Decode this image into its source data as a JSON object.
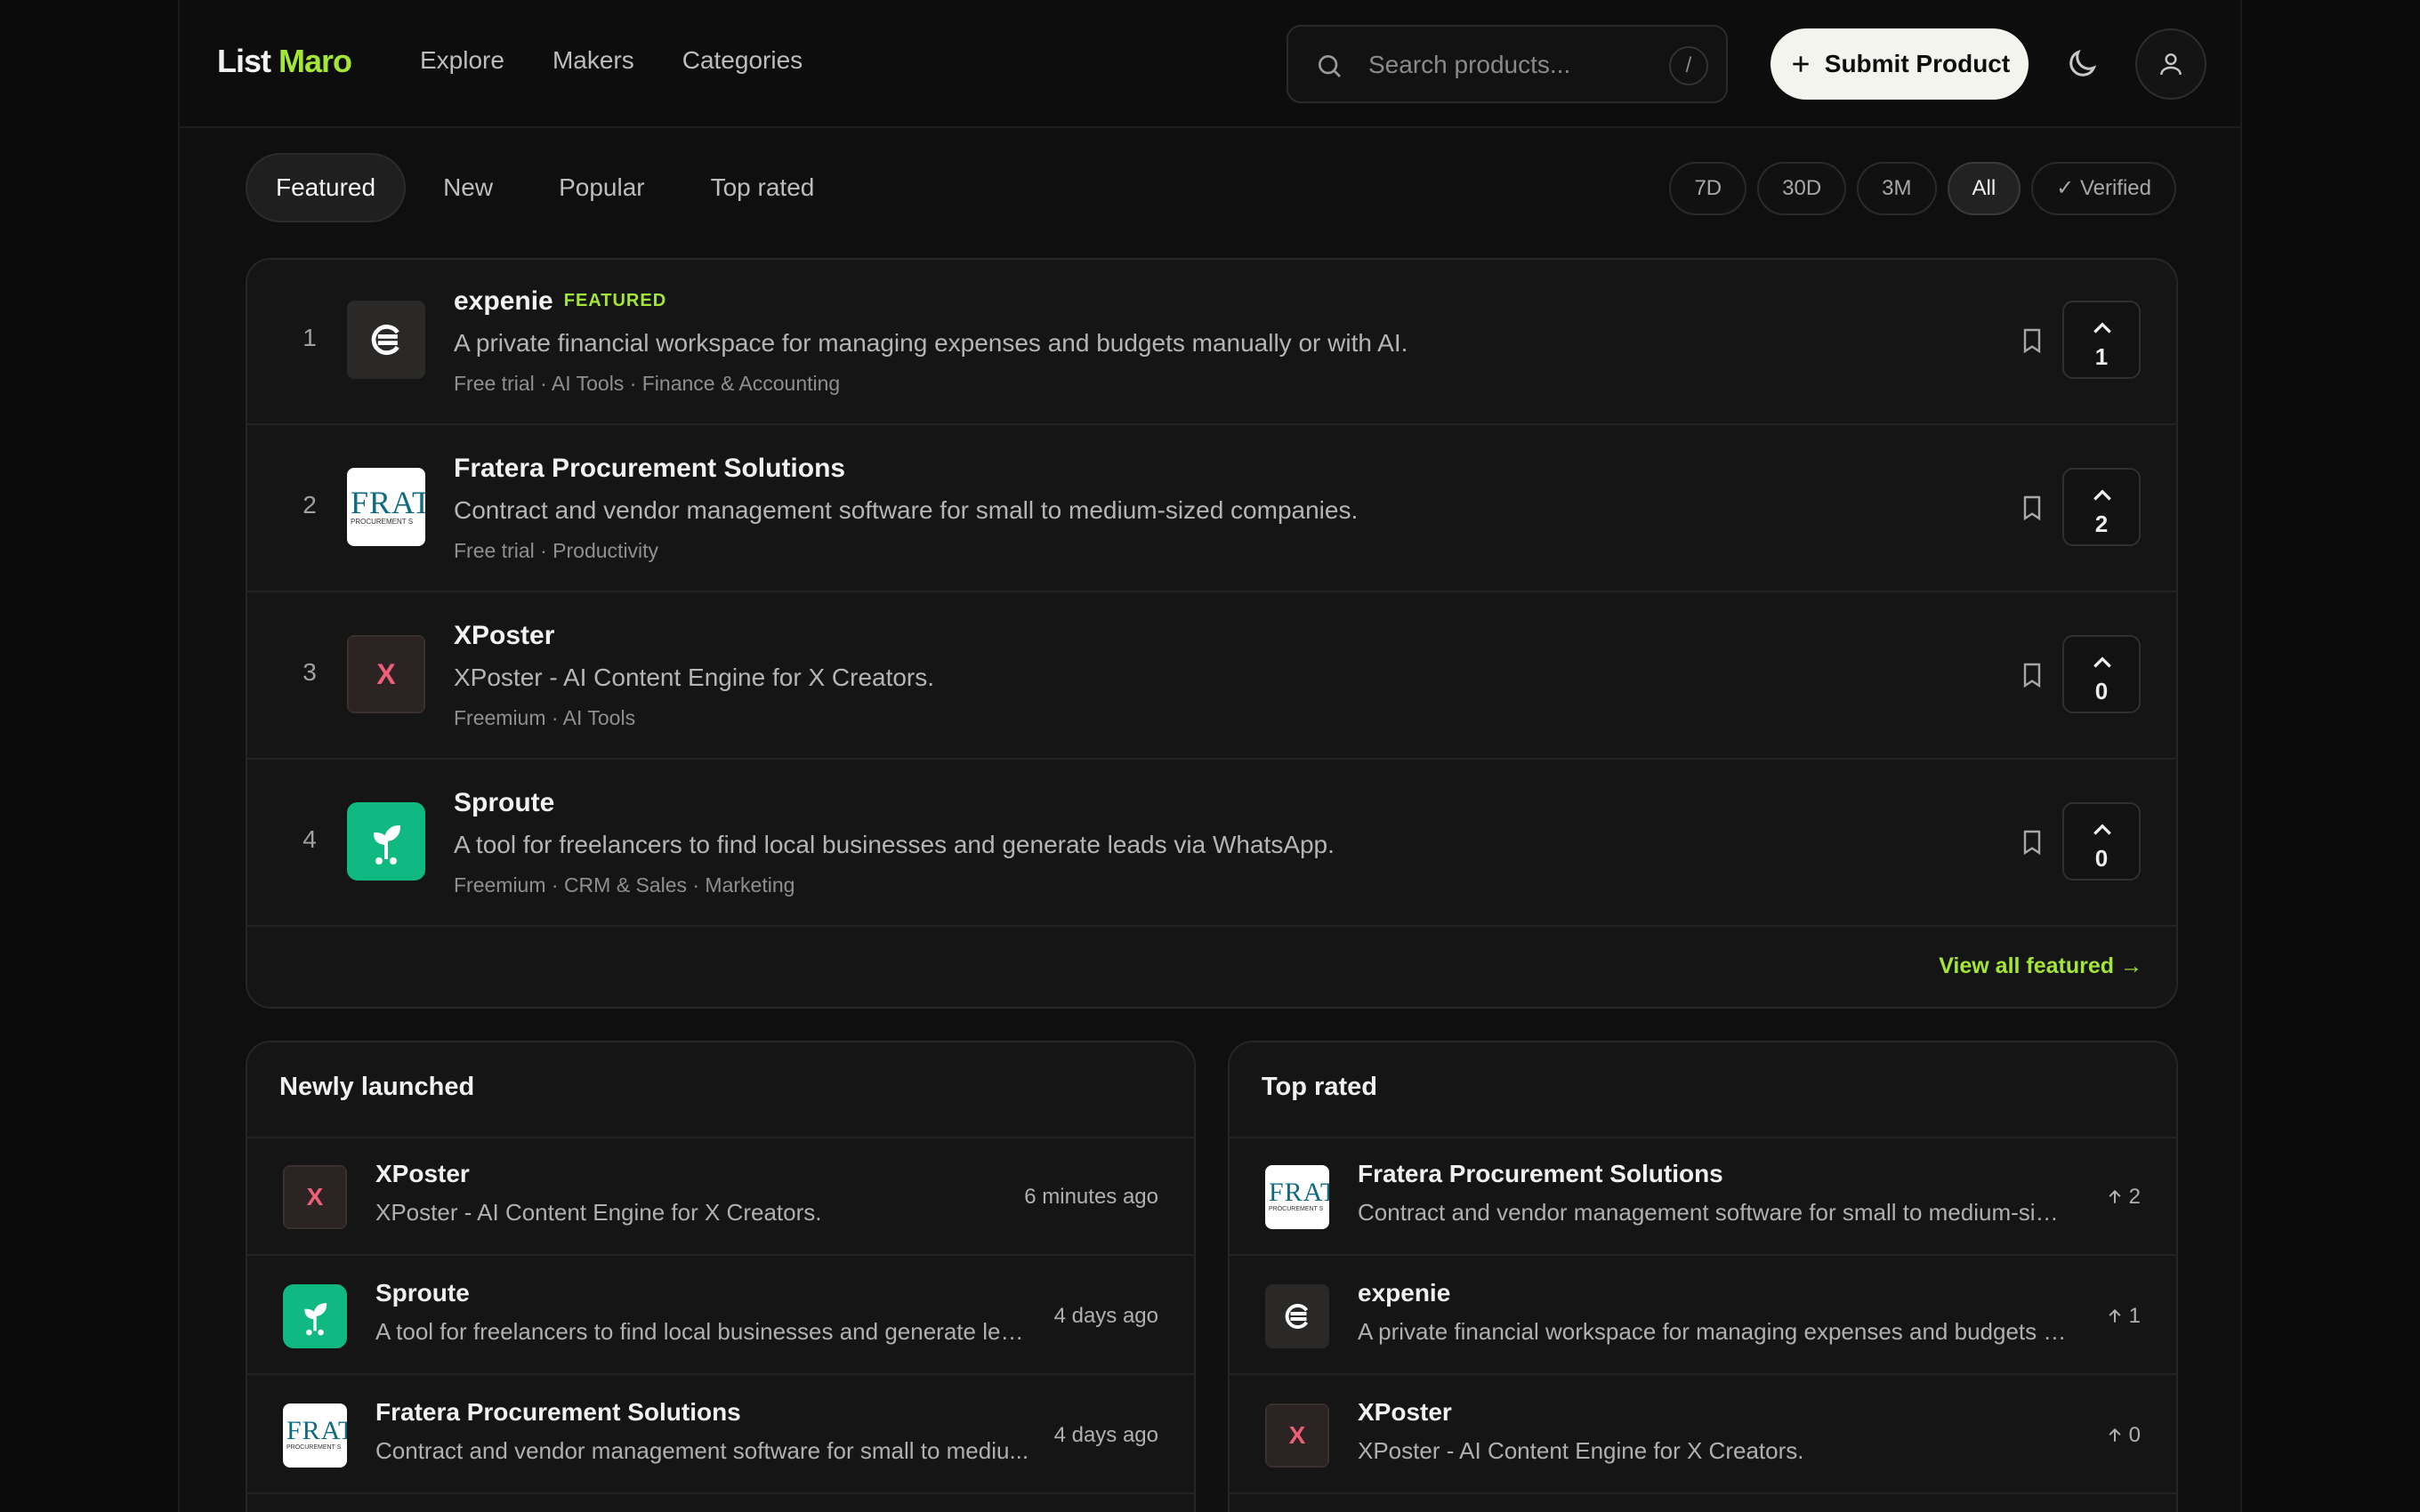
{
  "header": {
    "logo_part1": "List",
    "logo_part2": "Maro",
    "nav": [
      "Explore",
      "Makers",
      "Categories"
    ],
    "search_placeholder": "Search products...",
    "search_shortcut": "/",
    "submit_label": "Submit Product"
  },
  "tabs": [
    "Featured",
    "New",
    "Popular",
    "Top rated"
  ],
  "active_tab": "Featured",
  "ranges": [
    "7D",
    "30D",
    "3M",
    "All",
    "✓ Verified"
  ],
  "active_range": "All",
  "featured": {
    "items": [
      {
        "rank": "1",
        "name": "expenie",
        "badge": "FEATURED",
        "desc": "A private financial workspace for managing expenses and budgets manually or with AI.",
        "tags": "Free trial · AI Tools · Finance & Accounting",
        "votes": "1",
        "logo": "expenie"
      },
      {
        "rank": "2",
        "name": "Fratera Procurement Solutions",
        "badge": "",
        "desc": "Contract and vendor management software for small to medium-sized companies.",
        "tags": "Free trial · Productivity",
        "votes": "2",
        "logo": "fratera"
      },
      {
        "rank": "3",
        "name": "XPoster",
        "badge": "",
        "desc": "XPoster - AI Content Engine for X Creators.",
        "tags": "Freemium · AI Tools",
        "votes": "0",
        "logo": "xposter"
      },
      {
        "rank": "4",
        "name": "Sproute",
        "badge": "",
        "desc": "A tool for freelancers to find local businesses and generate leads via WhatsApp.",
        "tags": "Freemium · CRM & Sales · Marketing",
        "votes": "0",
        "logo": "sproute"
      }
    ],
    "view_all": "View all featured →"
  },
  "logo_text": {
    "xposter": "X",
    "fratera_big": "FRATE",
    "fratera_small": "PROCUREMENT S"
  },
  "newly_launched": {
    "title": "Newly launched",
    "items": [
      {
        "name": "XPoster",
        "desc": "XPoster - AI Content Engine for X Creators.",
        "time": "6 minutes ago",
        "logo": "xposter"
      },
      {
        "name": "Sproute",
        "desc": "A tool for freelancers to find local businesses and generate lead...",
        "time": "4 days ago",
        "logo": "sproute"
      },
      {
        "name": "Fratera Procurement Solutions",
        "desc": "Contract and vendor management software for small to mediu...",
        "time": "4 days ago",
        "logo": "fratera"
      }
    ]
  },
  "top_rated": {
    "title": "Top rated",
    "items": [
      {
        "name": "Fratera Procurement Solutions",
        "desc": "Contract and vendor management software for small to medium-size...",
        "votes": "2",
        "logo": "fratera"
      },
      {
        "name": "expenie",
        "desc": "A private financial workspace for managing expenses and budgets m...",
        "votes": "1",
        "logo": "expenie"
      },
      {
        "name": "XPoster",
        "desc": "XPoster - AI Content Engine for X Creators.",
        "votes": "0",
        "logo": "xposter"
      }
    ]
  },
  "colors": {
    "accent": "#a3e635",
    "background": "#0f0f0f",
    "card": "#151515",
    "xposter_red": "#ef5f7a",
    "sproute_green": "#10b981"
  },
  "icons": {
    "search": "search-icon",
    "plus": "plus-icon",
    "theme": "moon-icon",
    "user": "user-icon",
    "bookmark": "bookmark-icon",
    "upvote": "chevron-up-icon",
    "arrow_up": "arrow-up-icon"
  }
}
